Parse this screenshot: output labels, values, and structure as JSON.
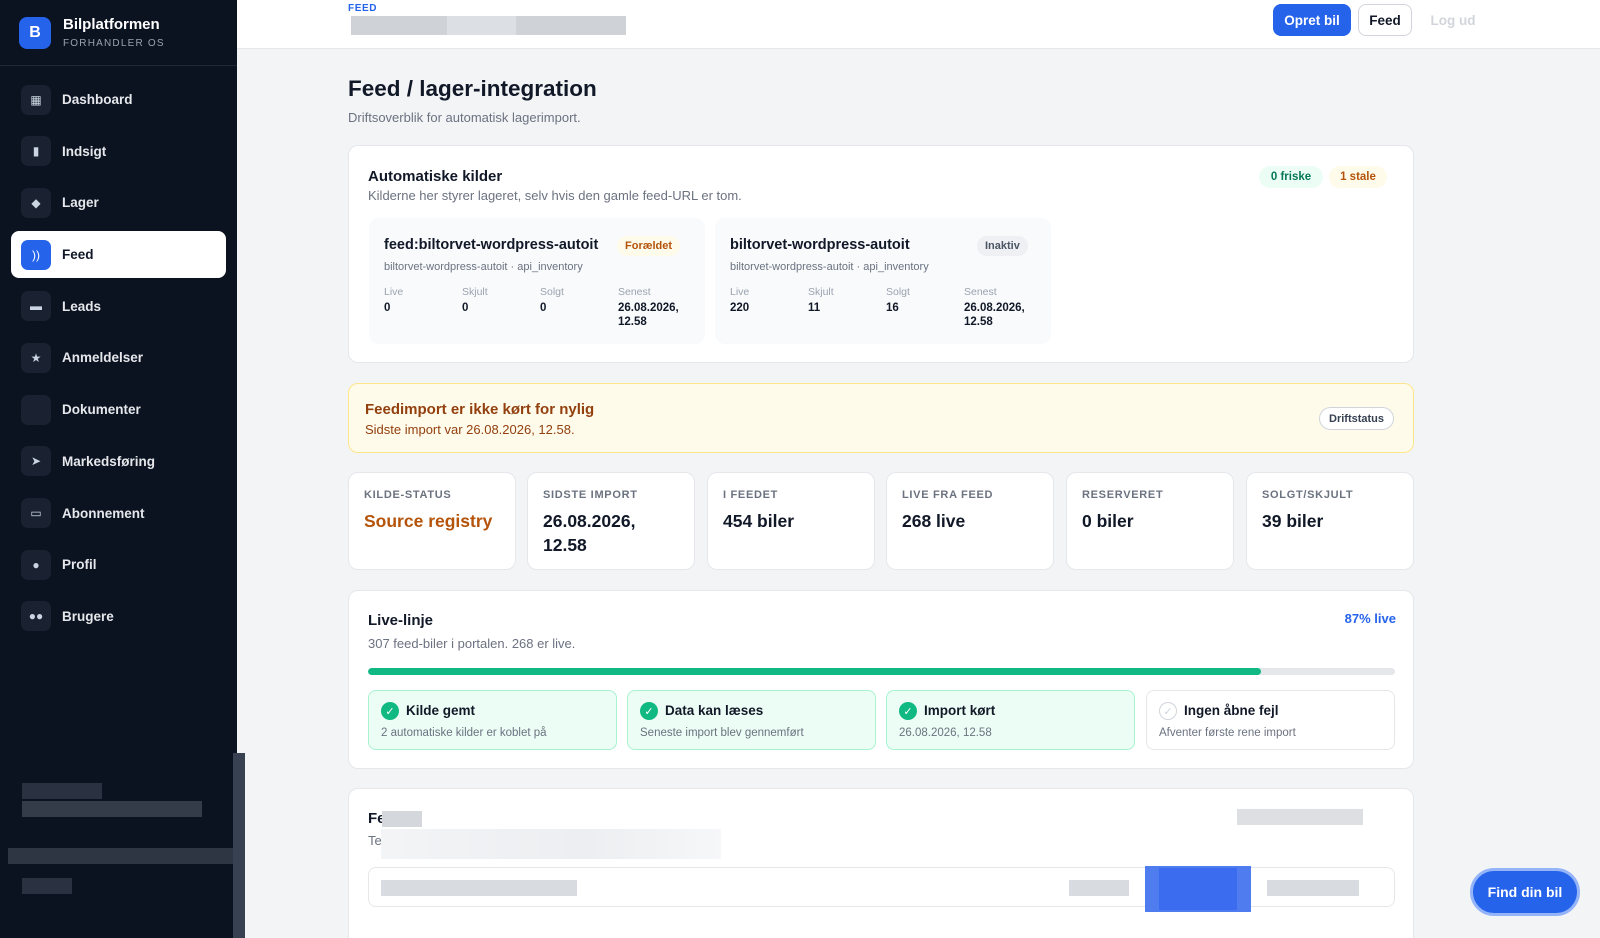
{
  "brand": {
    "logo": "B",
    "name": "Bilplatformen",
    "subtitle": "FORHANDLER OS"
  },
  "nav": [
    {
      "label": "Dashboard",
      "icon": "▦"
    },
    {
      "label": "Indsigt",
      "icon": "▮"
    },
    {
      "label": "Lager",
      "icon": "◆"
    },
    {
      "label": "Feed",
      "icon": "))"
    },
    {
      "label": "Leads",
      "icon": "▬"
    },
    {
      "label": "Anmeldelser",
      "icon": "★"
    },
    {
      "label": "Dokumenter",
      "icon": ""
    },
    {
      "label": "Markedsføring",
      "icon": "➤"
    },
    {
      "label": "Abonnement",
      "icon": "▭"
    },
    {
      "label": "Profil",
      "icon": "●"
    },
    {
      "label": "Brugere",
      "icon": "●●"
    }
  ],
  "active_nav": "Feed",
  "topbar": {
    "eyebrow": "FEED",
    "create_label": "Opret bil",
    "feed_label": "Feed",
    "logout_label": "Log ud"
  },
  "page": {
    "title": "Feed / lager-integration",
    "subtitle": "Driftsoverblik for automatisk lagerimport."
  },
  "sources": {
    "title": "Automatiske kilder",
    "subtitle": "Kilderne her styrer lageret, selv hvis den gamle feed-URL er tom.",
    "fresh_pill": "0 friske",
    "stale_pill": "1 stale",
    "items": [
      {
        "name": "feed:biltorvet-wordpress-autoit",
        "badge": "Forældet",
        "meta": "biltorvet-wordpress-autoit · api_inventory",
        "stats": [
          {
            "label": "Live",
            "value": "0"
          },
          {
            "label": "Skjult",
            "value": "0"
          },
          {
            "label": "Solgt",
            "value": "0"
          },
          {
            "label": "Senest",
            "value": "26.08.2026, 12.58"
          }
        ]
      },
      {
        "name": "biltorvet-wordpress-autoit",
        "badge": "Inaktiv",
        "meta": "biltorvet-wordpress-autoit · api_inventory",
        "stats": [
          {
            "label": "Live",
            "value": "220"
          },
          {
            "label": "Skjult",
            "value": "11"
          },
          {
            "label": "Solgt",
            "value": "16"
          },
          {
            "label": "Senest",
            "value": "26.08.2026, 12.58"
          }
        ]
      }
    ]
  },
  "alert": {
    "title": "Feedimport er ikke kørt for nylig",
    "subtitle": "Sidste import var 26.08.2026, 12.58.",
    "badge": "Driftstatus"
  },
  "kpis": [
    {
      "label": "KILDE-STATUS",
      "value": "Source registry"
    },
    {
      "label": "SIDSTE IMPORT",
      "value": "26.08.2026, 12.58"
    },
    {
      "label": "I FEEDET",
      "value": "454 biler"
    },
    {
      "label": "LIVE FRA FEED",
      "value": "268 live"
    },
    {
      "label": "RESERVERET",
      "value": "0 biler"
    },
    {
      "label": "SOLGT/SKJULT",
      "value": "39 biler"
    }
  ],
  "live": {
    "title": "Live-linje",
    "subtitle": "307 feed-biler i portalen. 268 er live.",
    "pct_label": "87% live",
    "progress": 0.87,
    "steps": [
      {
        "title": "Kilde gemt",
        "sub": "2 automatiske kilder er koblet på",
        "done": true
      },
      {
        "title": "Data kan læses",
        "sub": "Seneste import blev gennemført",
        "done": true
      },
      {
        "title": "Import kørt",
        "sub": "26.08.2026, 12.58",
        "done": true
      },
      {
        "title": "Ingen åbne fejl",
        "sub": "Afventer første rene import",
        "done": false
      }
    ]
  },
  "bottom": {
    "title_fragment": "Fe",
    "sub_fragment": "Te"
  },
  "fab": {
    "label": "Find din bil"
  },
  "colors": {
    "accent": "#2563eb",
    "sidebar": "#0b1220",
    "success": "#10b981",
    "warning": "#b45309"
  }
}
